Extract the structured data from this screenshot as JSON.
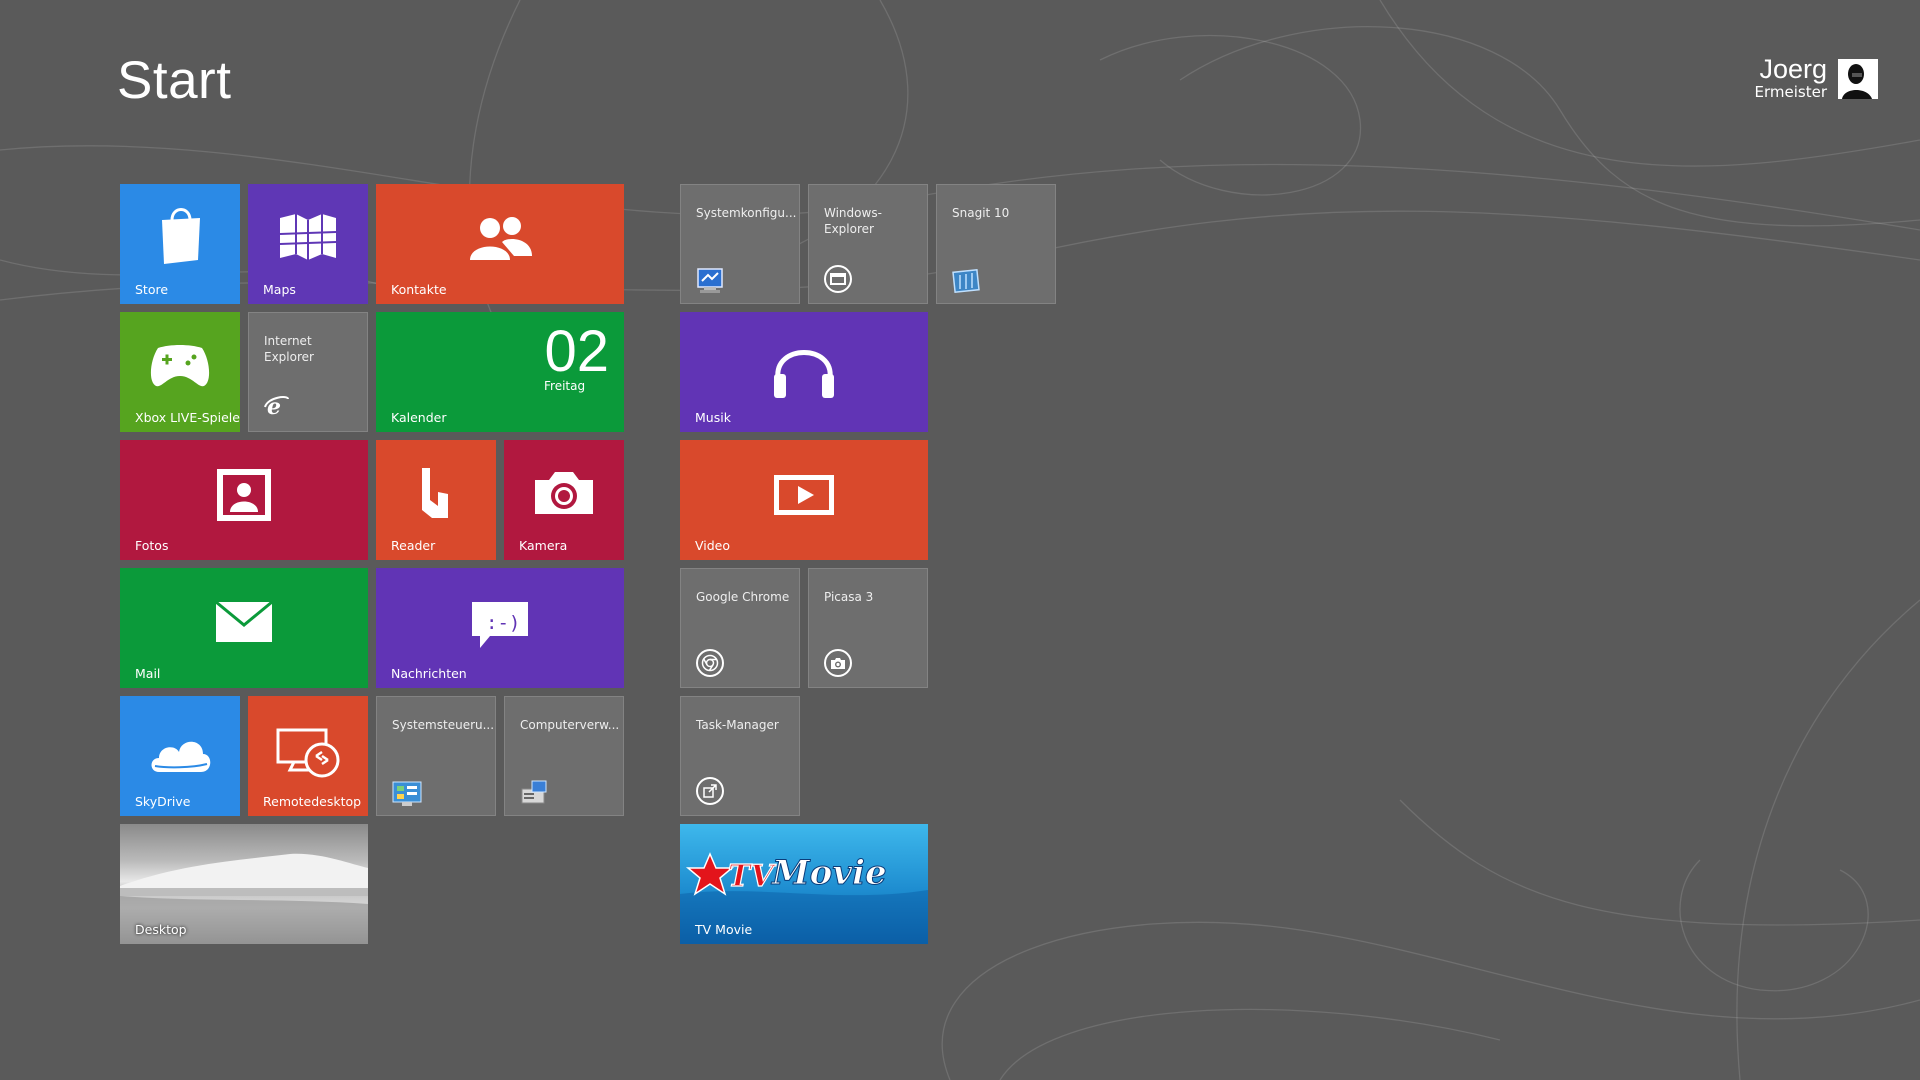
{
  "header": {
    "title": "Start",
    "user_name": "Joerg",
    "user_sub": "Ermeister"
  },
  "colors": {
    "background": "#5a5a5a",
    "blue": "#2b8ae6",
    "purple": "#5f37b5",
    "orange": "#d9492c",
    "green": "#0b9a3a",
    "lime": "#56a41f",
    "crimson": "#b1183f",
    "desktop_tile": "#6e6e6e"
  },
  "tiles": {
    "store": {
      "label": "Store",
      "icon": "shopping-bag-icon"
    },
    "maps": {
      "label": "Maps",
      "icon": "map-icon"
    },
    "kontakte": {
      "label": "Kontakte",
      "icon": "people-icon"
    },
    "xbox": {
      "label": "Xbox LIVE-Spiele",
      "icon": "gamepad-icon"
    },
    "ie": {
      "label": "Internet Explorer",
      "icon": "internet-explorer-icon"
    },
    "kalender": {
      "label": "Kalender",
      "date": "02",
      "day": "Freitag",
      "icon": "calendar-icon"
    },
    "fotos": {
      "label": "Fotos",
      "icon": "photo-icon"
    },
    "reader": {
      "label": "Reader",
      "icon": "reader-icon"
    },
    "kamera": {
      "label": "Kamera",
      "icon": "camera-icon"
    },
    "mail": {
      "label": "Mail",
      "icon": "envelope-icon"
    },
    "nachrichten": {
      "label": "Nachrichten",
      "icon": "chat-bubble-icon",
      "emoticon": ":-)"
    },
    "skydrive": {
      "label": "SkyDrive",
      "icon": "cloud-icon"
    },
    "remote": {
      "label": "Remotedesktop",
      "icon": "remote-desktop-icon"
    },
    "systemsteuerung": {
      "label": "Systemsteueru...",
      "icon": "control-panel-icon"
    },
    "computerverwaltung": {
      "label": "Computerverw...",
      "icon": "computer-management-icon"
    },
    "desktop": {
      "label": "Desktop",
      "icon": "desktop-wallpaper"
    },
    "systemkonfig": {
      "label": "Systemkonfigu...",
      "icon": "system-config-icon"
    },
    "explorer": {
      "label": "Windows-\nExplorer",
      "icon": "windows-explorer-icon"
    },
    "snagit": {
      "label": "Snagit 10",
      "icon": "snagit-icon"
    },
    "musik": {
      "label": "Musik",
      "icon": "headphones-icon"
    },
    "video": {
      "label": "Video",
      "icon": "play-icon"
    },
    "chrome": {
      "label": "Google Chrome",
      "icon": "chrome-icon"
    },
    "picasa": {
      "label": "Picasa 3",
      "icon": "picasa-camera-icon"
    },
    "taskmgr": {
      "label": "Task-Manager",
      "icon": "task-manager-icon"
    },
    "tvmovie": {
      "label": "TV Movie",
      "icon": "tv-movie-logo"
    }
  }
}
